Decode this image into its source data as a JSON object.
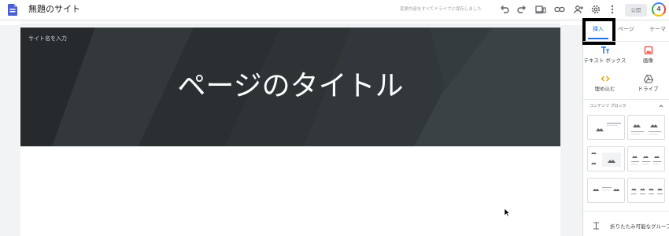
{
  "app": {
    "title": "無題のサイト",
    "save_status": "変更内容をすべてドライブに保存しました",
    "publish_label": "公開",
    "avatar_letter": "4",
    "accent_color": "#1a73e8"
  },
  "toolbar_icons": [
    "undo-icon",
    "redo-icon",
    "preview-icon",
    "link-icon",
    "share-icon",
    "settings-icon",
    "more-vert-icon"
  ],
  "header": {
    "site_name": "サイト名を入力",
    "page_title": "ページのタイトル"
  },
  "panel": {
    "tabs": [
      {
        "label": "挿入",
        "active": true
      },
      {
        "label": "ページ",
        "active": false
      },
      {
        "label": "テーマ",
        "active": false
      }
    ],
    "tools": [
      {
        "label": "テキスト ボックス",
        "icon": "text-box-icon"
      },
      {
        "label": "画像",
        "icon": "image-icon"
      },
      {
        "label": "埋め込む",
        "icon": "embed-icon"
      },
      {
        "label": "ドライブ",
        "icon": "drive-icon"
      }
    ],
    "content_blocks_label": "コンテンツ ブロック",
    "collapsible_label": "折りたたみ可能なグループ"
  }
}
